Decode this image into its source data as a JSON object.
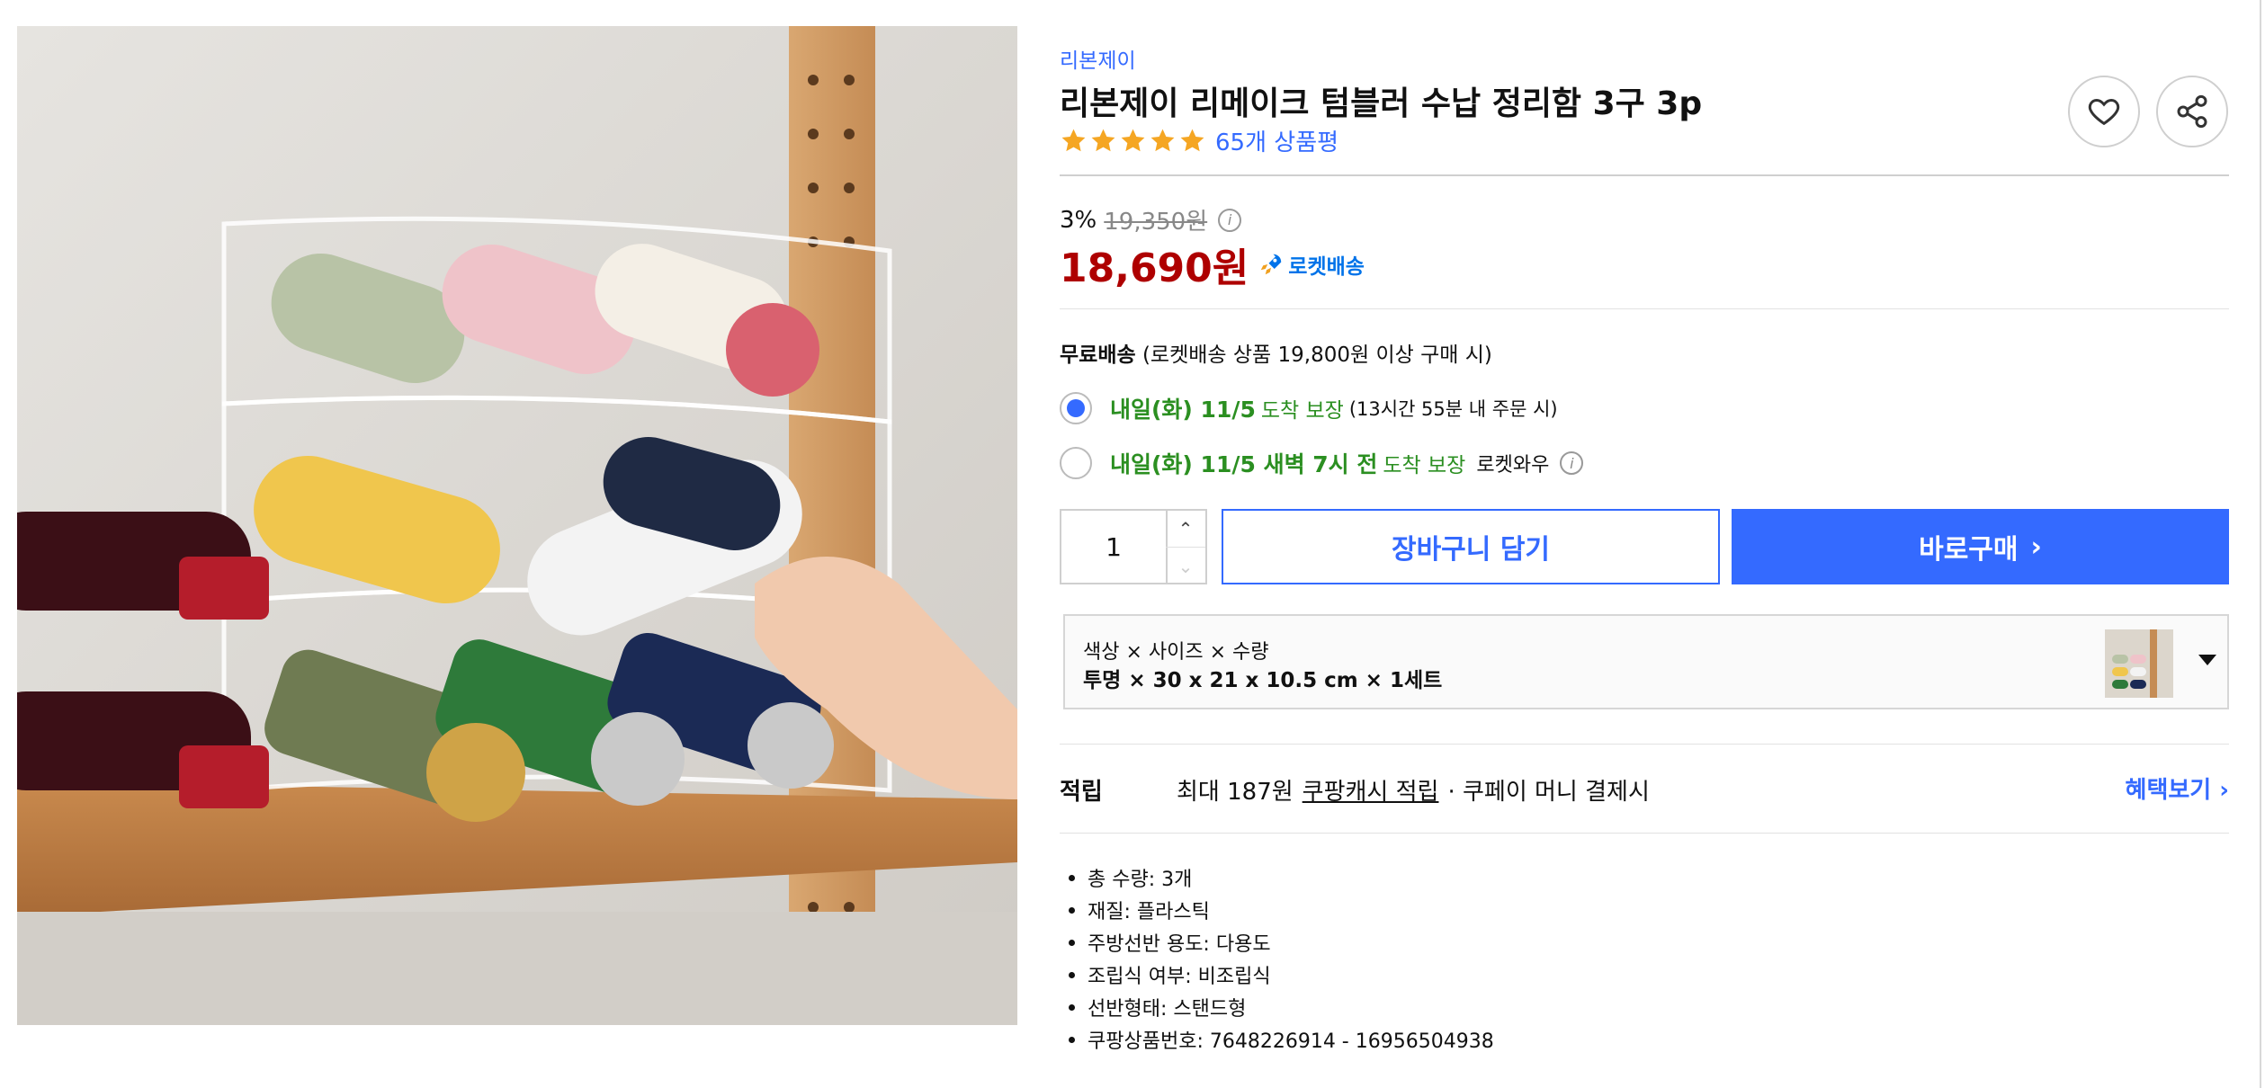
{
  "product": {
    "brand": "리본제이",
    "title": "리본제이 리메이크 텀블러 수납 정리함 3구 3p",
    "rating_stars": 5,
    "review_count": "65개 상품평"
  },
  "price": {
    "discount": "3%",
    "original": "19,350원",
    "sale": "18,690원",
    "rocket_label": "로켓배송"
  },
  "shipping": {
    "free_label": "무료배송",
    "free_note": "(로켓배송 상품 19,800원 이상 구매 시)",
    "options": [
      {
        "date": "내일(화) 11/5",
        "guarantee": "도착 보장",
        "note": "(13시간 55분 내 주문 시)",
        "selected": true
      },
      {
        "date": "내일(화) 11/5 새벽 7시 전",
        "guarantee": "도착 보장",
        "extra": "로켓와우",
        "selected": false
      }
    ]
  },
  "purchase": {
    "quantity": "1",
    "cart_label": "장바구니 담기",
    "buy_label": "바로구매"
  },
  "option": {
    "label": "색상 × 사이즈 × 수량",
    "value": "투명 × 30 x 21 x 10.5 cm × 1세트"
  },
  "points": {
    "label": "적립",
    "prefix": "최대 187원",
    "link": "쿠팡캐시 적립",
    "suffix": "· 쿠페이 머니 결제시",
    "benefit_link": "혜택보기"
  },
  "specs": [
    "총 수량: 3개",
    "재질: 플라스틱",
    "주방선반 용도: 다용도",
    "조립식 여부: 비조립식",
    "선반형태: 스탠드형",
    "쿠팡상품번호: 7648226914 - 16956504938"
  ],
  "colors": {
    "accent": "#346aff",
    "sale_price": "#ae0000",
    "delivery_green": "#2b8f21",
    "rocket_blue": "#0073e9",
    "star": "#f5a623"
  }
}
